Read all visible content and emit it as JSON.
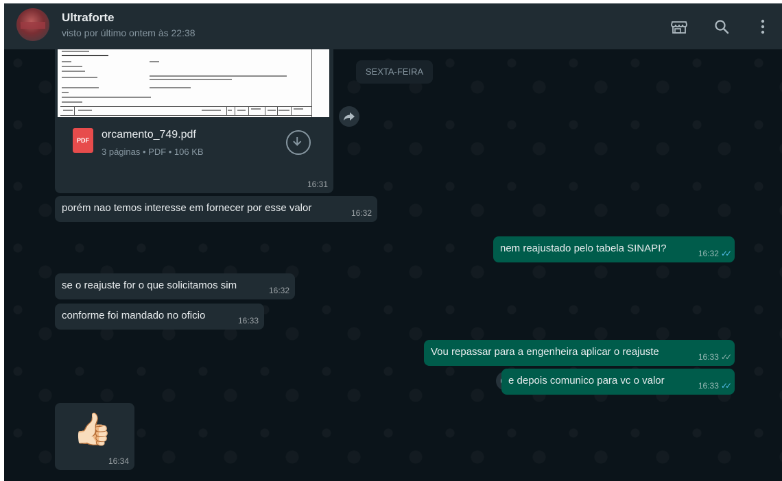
{
  "header": {
    "contact_name": "Ultraforte",
    "status": "visto por último ontem às 22:38",
    "icons": [
      "catalog-icon",
      "search-icon",
      "menu-icon"
    ]
  },
  "chat": {
    "day_separator": "SEXTA-FEIRA",
    "file_message": {
      "file_name": "orcamento_749.pdf",
      "meta": "3 páginas • PDF • 106 KB",
      "badge": "PDF",
      "time": "16:31"
    },
    "messages": [
      {
        "direction": "in",
        "text": "porém nao temos interesse em fornecer por esse valor",
        "time": "16:32"
      },
      {
        "direction": "out",
        "text": "nem reajustado pelo tabela SINAPI?",
        "time": "16:32",
        "status": "read"
      },
      {
        "direction": "in",
        "text": "se o reajuste for o que solicitamos sim",
        "time": "16:32"
      },
      {
        "direction": "in",
        "text": "conforme foi mandado no oficio",
        "time": "16:33"
      },
      {
        "direction": "out",
        "text": "Vou repassar para a engenheira aplicar o reajuste",
        "time": "16:33",
        "status": "delivered"
      },
      {
        "direction": "out",
        "text": "e depois comunico para vc o valor",
        "time": "16:33",
        "status": "read"
      }
    ],
    "sticker_message": {
      "emoji": "👍🏻",
      "time": "16:34"
    }
  },
  "colors": {
    "incoming_bubble": "#202c33",
    "outgoing_bubble": "#005c4b",
    "read_tick": "#53bdeb",
    "chat_background": "#0b141a"
  }
}
